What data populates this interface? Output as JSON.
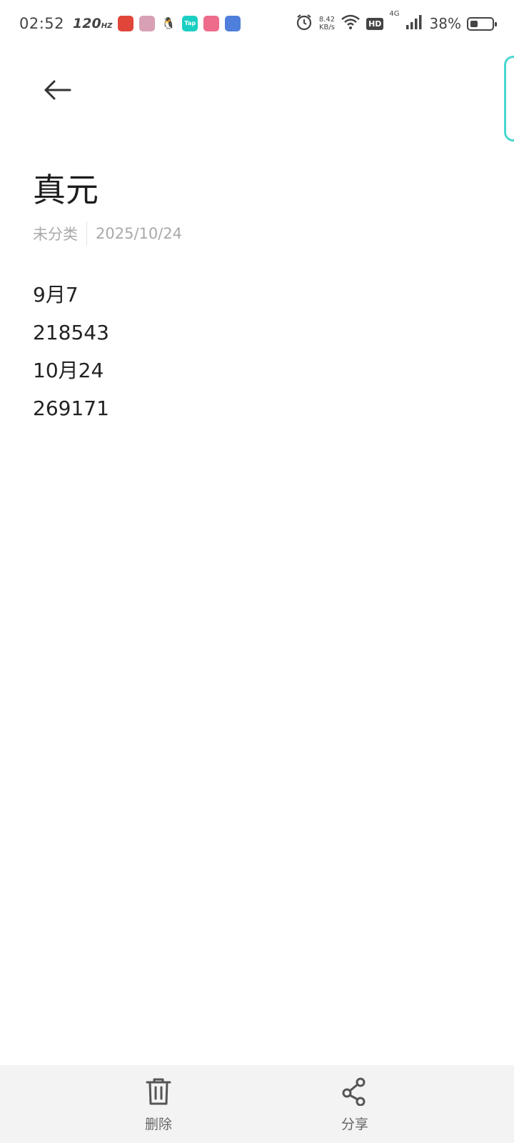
{
  "status_bar": {
    "time": "02:52",
    "refresh_rate": "120",
    "refresh_unit": "HZ",
    "speed_value": "8.42",
    "speed_unit": "KB/s",
    "hd": "HD",
    "network": "4G",
    "battery_pct": "38%"
  },
  "note": {
    "title": "真元",
    "category": "未分类",
    "date": "2025/10/24",
    "lines": [
      "9月7",
      "218543",
      "10月24",
      "269171"
    ]
  },
  "bottom_bar": {
    "delete_label": "删除",
    "share_label": "分享"
  },
  "colors": {
    "accent": "#48d6d0",
    "bottom_bar_bg": "#f3f3f3",
    "meta_text": "#a9a9a9"
  }
}
